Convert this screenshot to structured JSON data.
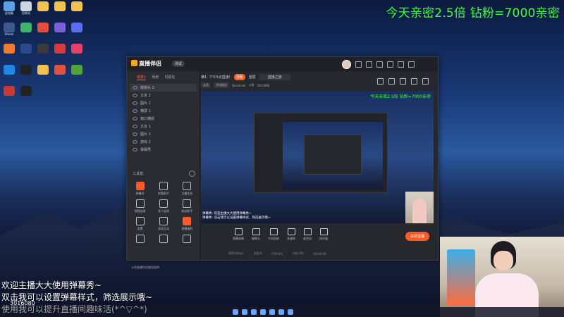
{
  "banner": "今天亲密2.5倍 钻粉=7000亲密",
  "desktop_icons": [
    {
      "label": "此电脑",
      "color": "#5aa0e6"
    },
    {
      "label": "回收站",
      "color": "#cfd6e0"
    },
    {
      "label": "",
      "color": "#f2c14e"
    },
    {
      "label": "",
      "color": "#f2c14e"
    },
    {
      "label": "",
      "color": "#f2c14e"
    },
    {
      "label": "Steam",
      "color": "#3b5a8a"
    },
    {
      "label": "",
      "color": "#3fb46a"
    },
    {
      "label": "",
      "color": "#e24d3d"
    },
    {
      "label": "",
      "color": "#7a60d8"
    },
    {
      "label": "",
      "color": "#5a6cf0"
    },
    {
      "label": "",
      "color": "#f07a2a"
    },
    {
      "label": "",
      "color": "#2a4a8a"
    },
    {
      "label": "",
      "color": "#3a3a3a"
    },
    {
      "label": "",
      "color": "#d83a3a"
    },
    {
      "label": "",
      "color": "#e63f6a"
    },
    {
      "label": "",
      "color": "#1e88e5"
    },
    {
      "label": "",
      "color": "#222"
    },
    {
      "label": "",
      "color": "#f2c14e"
    },
    {
      "label": "",
      "color": "#e0533d"
    },
    {
      "label": "",
      "color": "#52a33a"
    },
    {
      "label": "",
      "color": "#c73a2f"
    },
    {
      "label": "",
      "color": "#222"
    }
  ],
  "app": {
    "logo": "直播伴侣",
    "version": "测试",
    "scene_tabs": [
      "场景1",
      "场景",
      "分屏",
      "可视化"
    ],
    "layers": [
      {
        "name": "摄像头 2",
        "selected": true
      },
      {
        "name": "文本 2",
        "selected": false
      },
      {
        "name": "图片 1",
        "selected": false
      },
      {
        "name": "横屏 1",
        "selected": false
      },
      {
        "name": "窗口捕捉",
        "selected": false
      },
      {
        "name": "文本 1",
        "selected": false
      },
      {
        "name": "图片 2",
        "selected": false
      },
      {
        "name": "游戏 2",
        "selected": false
      },
      {
        "name": "弹幕秀",
        "selected": false
      }
    ],
    "tools_title": "工具箱",
    "tools": [
      {
        "label": "弹幕秀",
        "hot": true
      },
      {
        "label": "房管助手",
        "hot": false
      },
      {
        "label": "主播任务",
        "hot": false
      },
      {
        "label": "视频连麦",
        "hot": false
      },
      {
        "label": "多人连线",
        "hot": false
      },
      {
        "label": "粉丝助手",
        "hot": false
      },
      {
        "label": "设置",
        "hot": false
      },
      {
        "label": "游戏互动",
        "hot": false
      },
      {
        "label": "直播福利",
        "hot": true
      },
      {
        "label": "",
        "hot": false
      },
      {
        "label": "",
        "hot": false
      },
      {
        "label": "",
        "hot": false
      }
    ],
    "notice": "斗鱼直播伴侣使用说明",
    "preview_bar": {
      "scene": "横1: 下午5点直播!",
      "badge": "场景",
      "mode": "竖屏",
      "title": "直播之旅"
    },
    "preview_bar2": [
      "品类",
      "游戏精选",
      "QuickLink",
      "斗鱼",
      "2013080"
    ],
    "canvas_overlay": "今天亲密2.5倍 钻粉=7000亲密",
    "canvas_chat": [
      "弹幕秀: 欢迎主播大大使用弹幕秀~",
      "弹幕秀: 双击我可以设置弹幕样式，筛选展示哦~"
    ],
    "bottom_tools": [
      "直播录像",
      "摄像头",
      "手机投屏",
      "多媒体",
      "麦克风",
      "扬声器"
    ],
    "go_live": "关闭直播",
    "status": [
      "码率:0kbps",
      "丢帧:0",
      "CPU:0%",
      "内存:0%",
      "00:00:00"
    ]
  },
  "chat": [
    {
      "text": "欢迎主播大大使用弹幕秀~",
      "prefix": "弹幕秀"
    },
    {
      "text": "双击我可以设置弹幕样式，筛选展示哦~",
      "prefix": "弹幕秀"
    },
    {
      "text": "使用我可以提升直播间趣味活(*^▽^*)",
      "prefix": "弹幕秀"
    }
  ],
  "chat_id": "3016080"
}
